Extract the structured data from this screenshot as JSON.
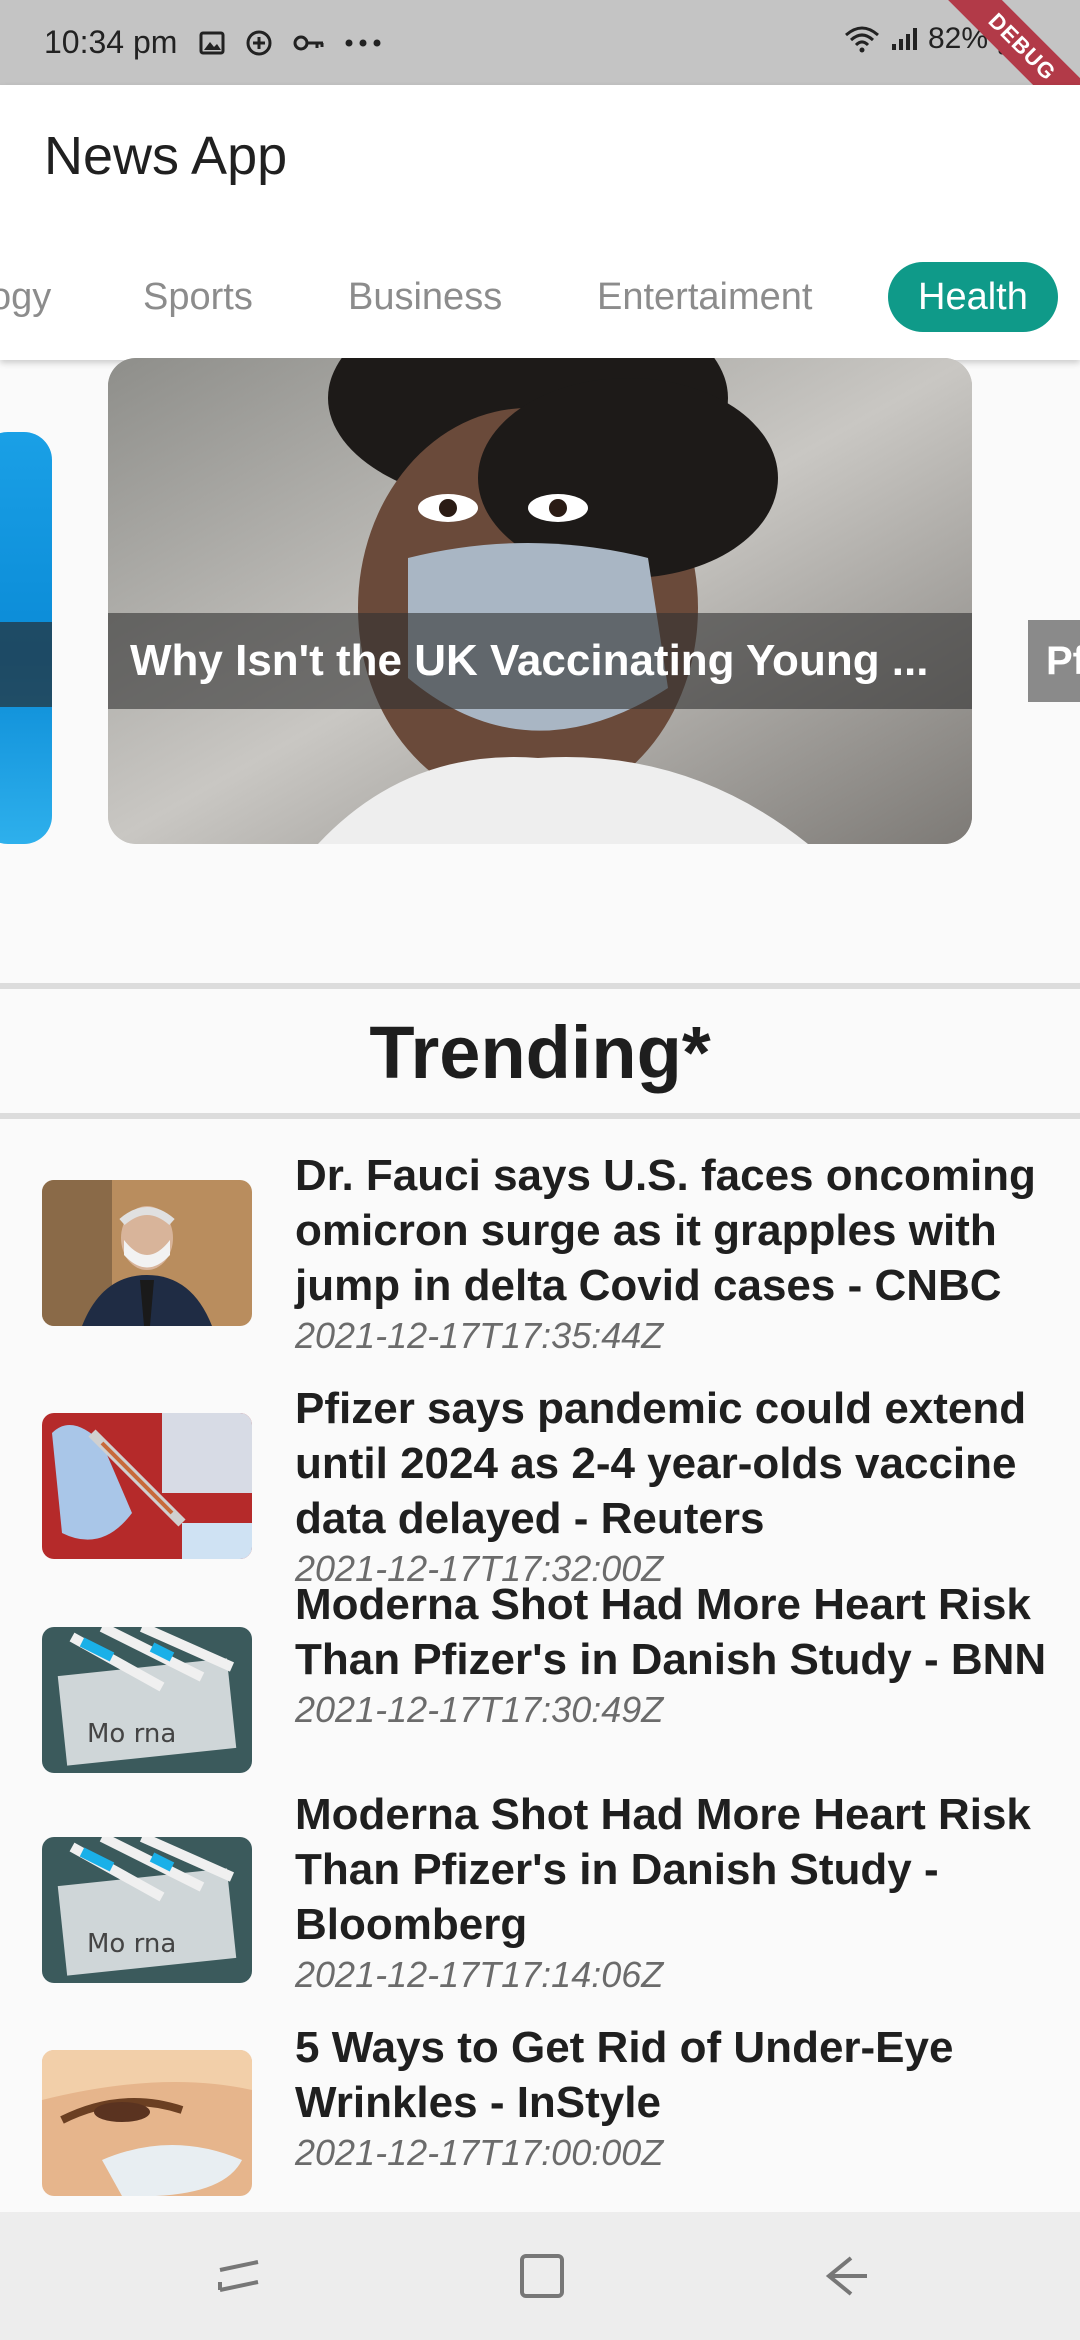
{
  "status_bar": {
    "time": "10:34 pm",
    "battery": "82%",
    "debug_label": "DEBUG"
  },
  "app_bar": {
    "title": "News App"
  },
  "tabs": [
    {
      "label": "ogy",
      "active": false
    },
    {
      "label": "Sports",
      "active": false
    },
    {
      "label": "Business",
      "active": false
    },
    {
      "label": "Entertaiment",
      "active": false
    },
    {
      "label": "Health",
      "active": true
    }
  ],
  "carousel": {
    "main_caption": "Why Isn't the UK Vaccinating Young ...",
    "right_peek_caption": "Pf"
  },
  "trending": {
    "title": "Trending*",
    "items": [
      {
        "title": "Dr. Fauci says U.S. faces oncoming omicron surge as it grapples with jump in delta Covid cases - CNBC",
        "date": "2021-12-17T17:35:44Z"
      },
      {
        "title": "Pfizer says pandemic could extend until 2024 as 2-4 year-olds vaccine data delayed - Reuters",
        "date": "2021-12-17T17:32:00Z"
      },
      {
        "title": "Moderna Shot Had More Heart Risk Than Pfizer's in Danish Study - BNN",
        "date": "2021-12-17T17:30:49Z"
      },
      {
        "title": "Moderna Shot Had More Heart Risk Than Pfizer's in Danish Study - Bloomberg",
        "date": "2021-12-17T17:14:06Z"
      },
      {
        "title": "5 Ways to Get Rid of Under-Eye Wrinkles - InStyle",
        "date": "2021-12-17T17:00:00Z"
      }
    ]
  },
  "colors": {
    "accent": "#0f9a89",
    "status_bar_bg": "#c4c4c4",
    "debug_ribbon": "#b23a48"
  }
}
